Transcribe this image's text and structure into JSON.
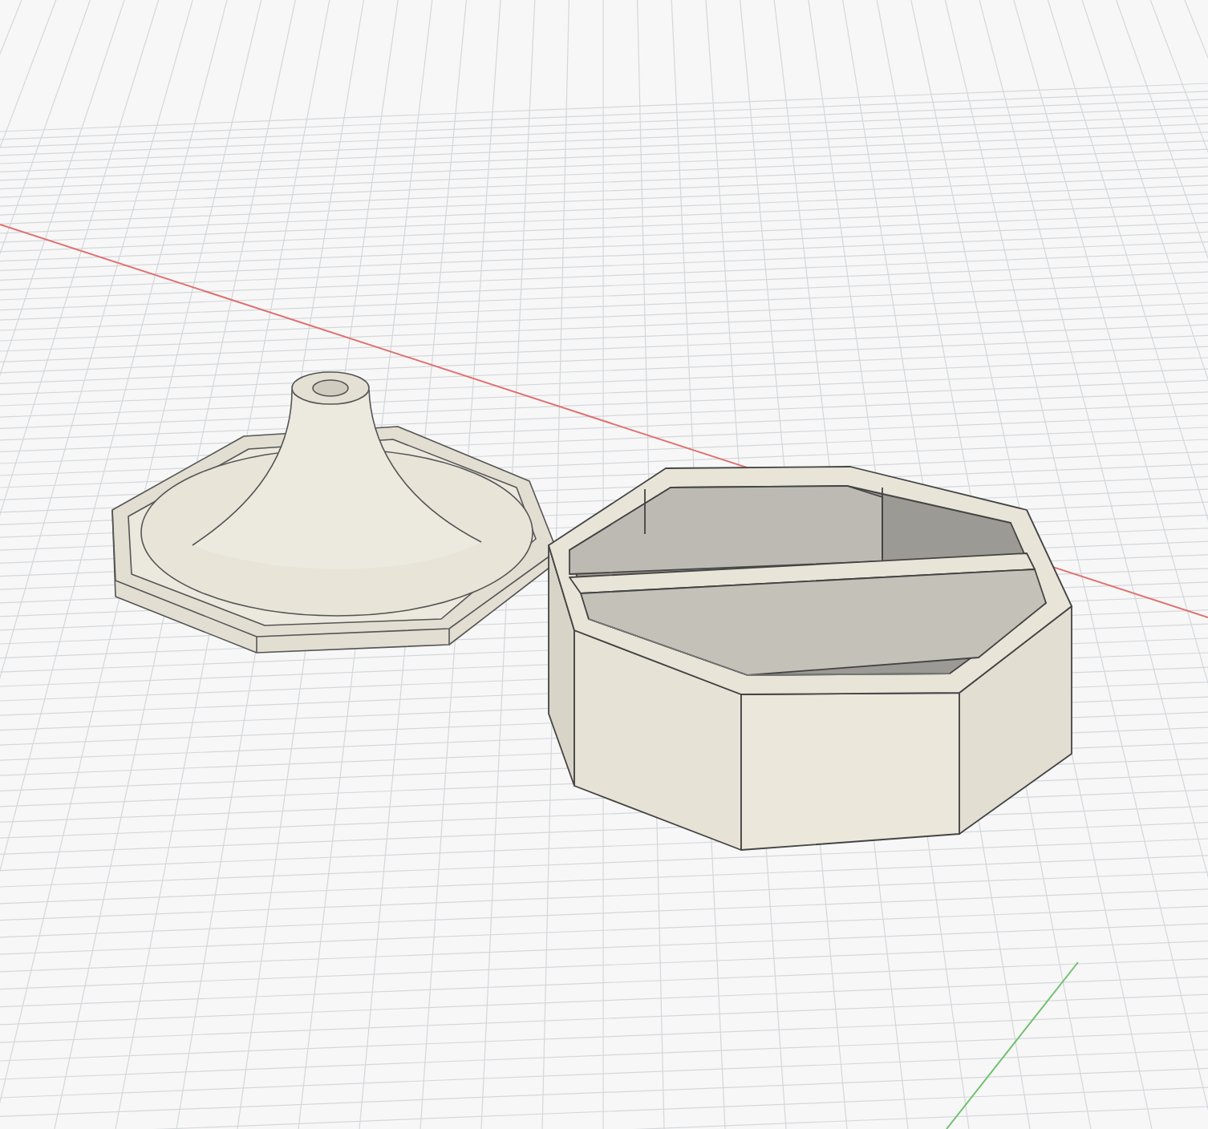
{
  "scene": {
    "objects": [
      {
        "kind": "lid"
      },
      {
        "kind": "box"
      }
    ]
  }
}
